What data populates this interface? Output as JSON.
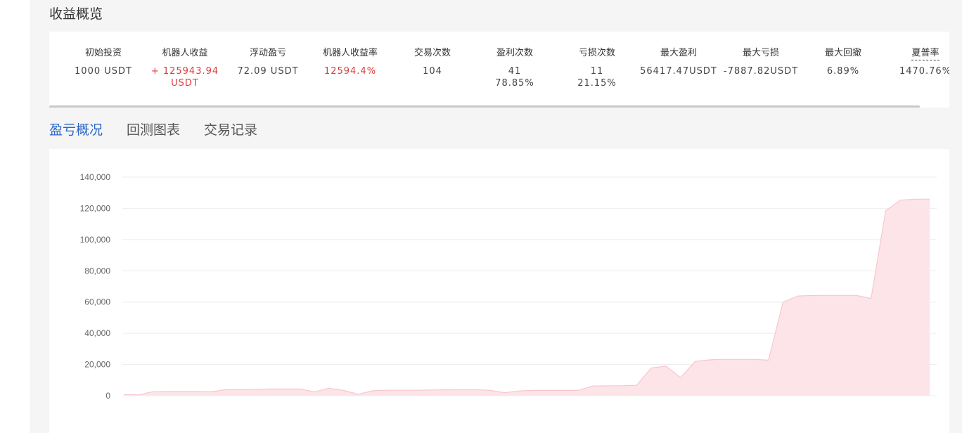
{
  "section_title": "收益概览",
  "stats": [
    {
      "label": "初始投资",
      "value": "1000 USDT",
      "value2": "",
      "color": "#444444"
    },
    {
      "label": "机器人收益",
      "value": "+ 125943.94",
      "value2": "USDT",
      "color": "#e03a3a"
    },
    {
      "label": "浮动盈亏",
      "value": "72.09 USDT",
      "value2": "",
      "color": "#444444"
    },
    {
      "label": "机器人收益率",
      "value": "12594.4%",
      "value2": "",
      "color": "#e03a3a"
    },
    {
      "label": "交易次数",
      "value": "104",
      "value2": "",
      "color": "#444444"
    },
    {
      "label": "盈利次数",
      "value": "41",
      "value2": "78.85%",
      "color": "#444444"
    },
    {
      "label": "亏损次数",
      "value": "11",
      "value2": "21.15%",
      "color": "#444444"
    },
    {
      "label": "最大盈利",
      "value": "56417.47USDT",
      "value2": "",
      "color": "#444444"
    },
    {
      "label": "最大亏损",
      "value": "-7887.82USDT",
      "value2": "",
      "color": "#444444"
    },
    {
      "label": "最大回撤",
      "value": "6.89%",
      "value2": "",
      "color": "#444444"
    },
    {
      "label": "夏普率",
      "value": "1470.76%",
      "value2": "",
      "color": "#444444"
    }
  ],
  "tabs": [
    {
      "label": "盈亏概况",
      "active": true
    },
    {
      "label": "回测图表",
      "active": false
    },
    {
      "label": "交易记录",
      "active": false
    }
  ],
  "colors": {
    "active_tab": "#2b66c9",
    "profit_red": "#e03a3a",
    "area_fill": "#fde4e8",
    "area_line": "#f8c6cf",
    "grid": "#ececec"
  },
  "chart_data": {
    "type": "area",
    "title": "",
    "xlabel": "",
    "ylabel": "",
    "ylim": [
      0,
      140000
    ],
    "yticks": [
      0,
      20000,
      40000,
      60000,
      80000,
      100000,
      120000,
      140000
    ],
    "ytick_labels": [
      "0",
      "20,000",
      "40,000",
      "60,000",
      "80,000",
      "100,000",
      "120,000",
      "140,000"
    ],
    "grid": true,
    "legend": "none",
    "series": [
      {
        "values": [
          800,
          600,
          2600,
          2800,
          2800,
          2800,
          2500,
          4000,
          4000,
          4200,
          4300,
          4300,
          4300,
          2500,
          4800,
          3400,
          1000,
          3200,
          3500,
          3500,
          3500,
          3700,
          3800,
          3900,
          3900,
          3400,
          2000,
          3100,
          3400,
          3400,
          3400,
          3400,
          6200,
          6400,
          6400,
          6700,
          17800,
          19000,
          11600,
          22000,
          23000,
          23300,
          23300,
          23300,
          22800,
          59900,
          63900,
          64200,
          64300,
          64300,
          64300,
          62300,
          118500,
          125300,
          125900,
          125900
        ]
      }
    ]
  }
}
